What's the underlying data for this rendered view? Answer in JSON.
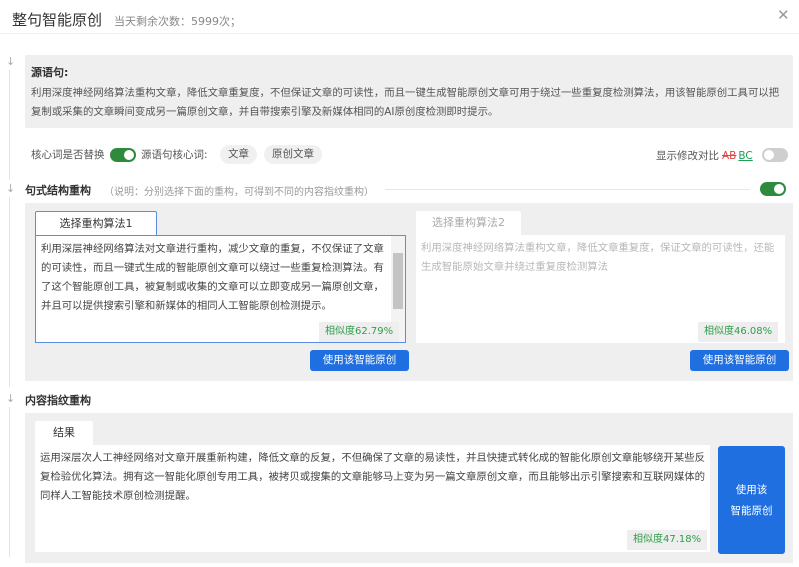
{
  "header": {
    "title": "整句智能原创",
    "remaining": "当天剩余次数：5999次；",
    "close_icon": "close-icon"
  },
  "source": {
    "label": "源语句:",
    "text": "利用深度神经网络算法重构文章，降低文章重复度，不但保证文章的可读性，而且一键生成智能原创文章可用于绕过一些重复度检测算法，用该智能原创工具可以把复制或采集的文章瞬间变成另一篇原创文章，并自带搜索引擎及新媒体相同的AI原创度检测即时提示。"
  },
  "keywords": {
    "replace_label": "核心词是否替换",
    "replace_on": true,
    "source_label": "源语句核心词:",
    "chips": [
      "文章",
      "原创文章"
    ],
    "compare_label": "显示修改对比",
    "compare_ab": "AB",
    "compare_bc": "BC",
    "compare_on": false
  },
  "structure": {
    "title": "句式结构重构",
    "note": "（说明：分别选择下面的重构，可得到不同的内容指纹重构）",
    "enabled": true,
    "options": [
      {
        "tab": "选择重构算法1",
        "text": "利用深层神经网络算法对文章进行重构，减少文章的重复，不仅保证了文章的可读性，而且一键式生成的智能原创文章可以绕过一些重复检测算法。有了这个智能原创工具，被复制或收集的文章可以立即变成另一篇原创文章，并且可以提供搜索引擎和新媒体的相同人工智能原创检测提示。",
        "similarity": "相似度62.79%",
        "button": "使用该智能原创"
      },
      {
        "tab": "选择重构算法2",
        "text": "利用深度神经网络算法重构文章，降低文章重复度，保证文章的可读性，还能生成智能原始文章并绕过重复度检测算法",
        "similarity": "相似度46.08%",
        "button": "使用该智能原创"
      }
    ]
  },
  "fingerprint": {
    "title": "内容指纹重构",
    "tab": "结果",
    "text": "运用深层次人工神经网络对文章开展重新构建，降低文章的反复，不但确保了文章的易读性，并且快捷式转化成的智能化原创文章能够绕开某些反复检验优化算法。拥有这一智能化原创专用工具，被拷贝或搜集的文章能够马上变为另一篇文章原创文章，而且能够出示引擎搜索和互联网媒体的同样人工智能技术原创检测提醒。",
    "similarity": "相似度47.18%",
    "button_line1": "使用该",
    "button_line2": "智能原创"
  },
  "colors": {
    "accent": "#1f6fe0",
    "toggle_on": "#2e8b3e",
    "similarity": "#2e9e4a"
  }
}
